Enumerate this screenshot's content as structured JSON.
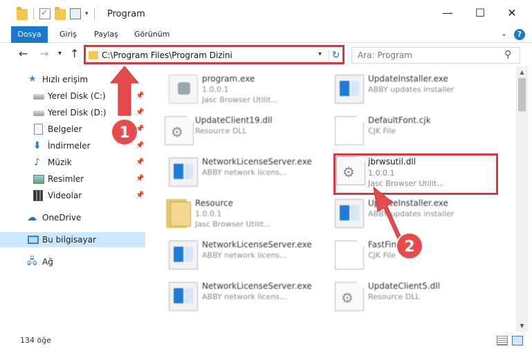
{
  "window": {
    "title": "Program"
  },
  "ribbon": {
    "tabs": [
      "Dosya",
      "Giriş",
      "Paylaş",
      "Görünüm"
    ]
  },
  "navigation": {
    "address": "C:\\Program Files\\Program Dizini",
    "search_placeholder": "Ara: Program"
  },
  "sidebar": {
    "items": [
      {
        "label": "Hızlı erişim",
        "icon": "star-icon"
      },
      {
        "label": "Yerel Disk (C:)",
        "icon": "drive-icon",
        "pinned": true
      },
      {
        "label": "Yerel Disk (D:)",
        "icon": "drive-icon",
        "pinned": true
      },
      {
        "label": "Belgeler",
        "icon": "document-icon",
        "pinned": true
      },
      {
        "label": "İndirmeler",
        "icon": "download-icon",
        "pinned": true
      },
      {
        "label": "Müzik",
        "icon": "music-icon",
        "pinned": true
      },
      {
        "label": "Resimler",
        "icon": "picture-icon",
        "pinned": true
      },
      {
        "label": "Videolar",
        "icon": "video-icon",
        "pinned": true
      },
      {
        "label": "OneDrive",
        "icon": "cloud-icon"
      },
      {
        "label": "Bu bilgisayar",
        "icon": "computer-icon",
        "selected": true
      },
      {
        "label": "Ağ",
        "icon": "network-icon"
      }
    ]
  },
  "files": [
    {
      "name": "program.exe",
      "line1": "1.0.0.1",
      "line2": "Jasc Browser Utilit...",
      "icon": "program-icon"
    },
    {
      "name": "UpdateInstaller.exe",
      "line1": "ABBY updates installer",
      "line2": "",
      "icon": "exe-icon"
    },
    {
      "name": "UpdateClient19.dll",
      "line1": "Resource DLL",
      "line2": "",
      "icon": "dll-icon"
    },
    {
      "name": "DefaultFont.cjk",
      "line1": "CJK File",
      "line2": "",
      "icon": "file-icon"
    },
    {
      "name": "NetworkLicenseServer.exe",
      "line1": "ABBY network licens...",
      "line2": "",
      "icon": "exe-icon"
    },
    {
      "name": "jbrwsutil.dll",
      "line1": "1.0.0.1",
      "line2": "Jasc Browser Utilit...",
      "icon": "dll-icon"
    },
    {
      "name": "Resource",
      "line1": "1.0.0.1",
      "line2": "Jasc Browser Utilit...",
      "icon": "folder-icon"
    },
    {
      "name": "UpdateInstaller.exe",
      "line1": "ABBY updates installer",
      "line2": "",
      "icon": "exe-icon"
    },
    {
      "name": "NetworkLicenseServer.exe",
      "line1": "ABBY network licens...",
      "line2": "",
      "icon": "exe-icon"
    },
    {
      "name": "FastFind.cjk",
      "line1": "CJK File",
      "line2": "",
      "icon": "file-icon"
    },
    {
      "name": "NetworkLicenseServer.exe",
      "line1": "ABBY network licens...",
      "line2": "",
      "icon": "exe-icon"
    },
    {
      "name": "UpdateClient5.dll",
      "line1": "Resource DLL",
      "line2": "",
      "icon": "dll-icon"
    }
  ],
  "status": {
    "item_count": "134 öğe"
  },
  "annotations": {
    "badge1": "1",
    "badge2": "2",
    "color": "#d9363e"
  }
}
